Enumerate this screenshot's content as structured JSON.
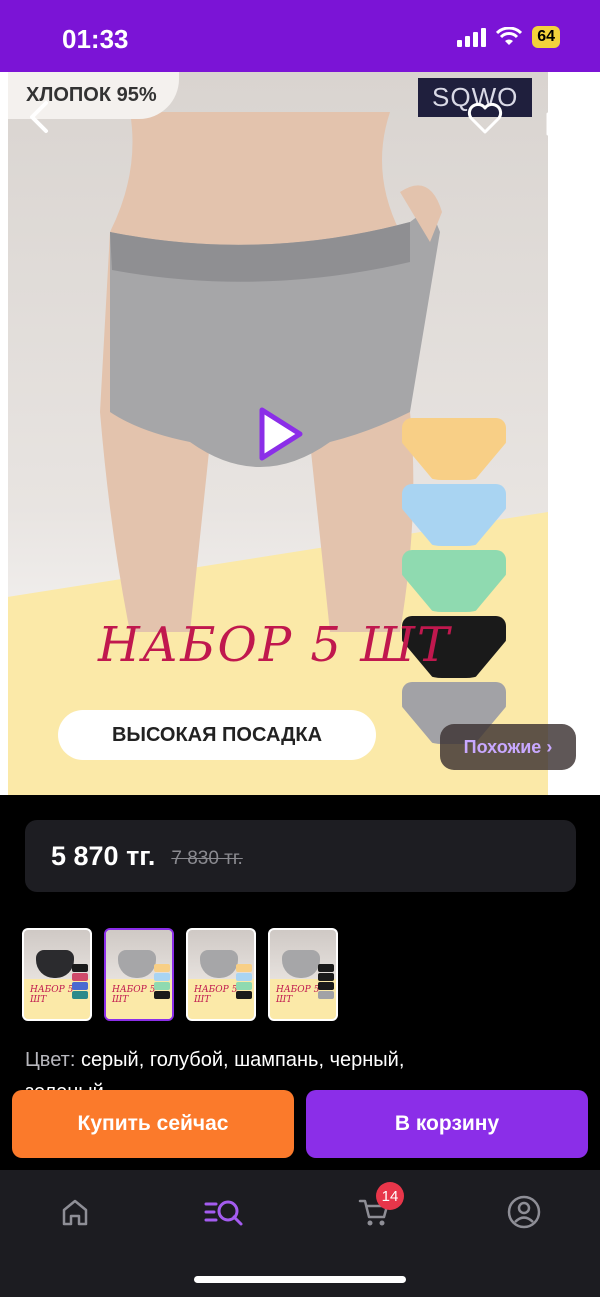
{
  "status_bar": {
    "time": "01:33",
    "battery": "64"
  },
  "product_image": {
    "cotton_label": "ХЛОПОК 95%",
    "brand": "SQWO",
    "set_title": "НАБОР 5 ШТ",
    "fit_label": "ВЫСОКАЯ ПОСАДКА",
    "similar_button": "Похожие ›",
    "brief_colors": [
      "#f8cf86",
      "#a9d4f2",
      "#8fdab0",
      "#1a1a1a",
      "#a2a2a6"
    ]
  },
  "price": {
    "current": "5 870 тг.",
    "old": "7 830 тг."
  },
  "thumbnails": {
    "selected_index": 1,
    "count": 4,
    "thumb_text": "НАБОР 5 ШТ"
  },
  "color": {
    "label": "Цвет:",
    "value": "серый, голубой, шампань, черный,",
    "value_line2": "зеленый"
  },
  "actions": {
    "buy_now": "Купить сейчас",
    "add_to_cart": "В корзину"
  },
  "tab_bar": {
    "cart_badge": "14",
    "active_tab": "catalog"
  },
  "colors": {
    "accent": "#8b2ee8",
    "status_bar": "#7b14d6",
    "buy_now": "#fb7a2b",
    "badge": "#e8364a"
  }
}
